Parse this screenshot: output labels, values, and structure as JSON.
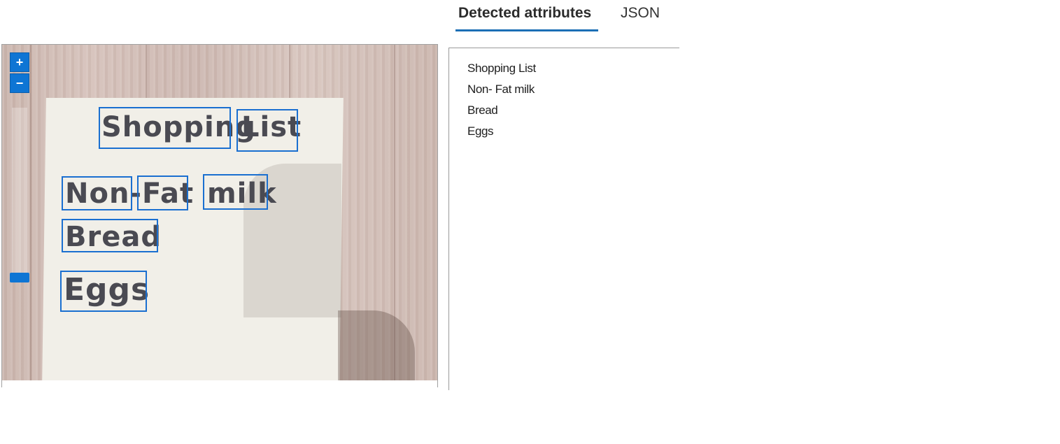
{
  "tabs": [
    {
      "label": "Detected attributes",
      "active": true
    },
    {
      "label": "JSON",
      "active": false
    }
  ],
  "viewer": {
    "zoom_in_label": "+",
    "zoom_out_label": "−",
    "handwriting": {
      "word1": "Shopping",
      "word2": "List",
      "word3": "Non-",
      "word4": "Fat",
      "word5": "milk",
      "word6": "Bread",
      "word7": "Eggs"
    },
    "box_color": "#1a6fd0"
  },
  "results": {
    "lines": [
      "Shopping List",
      "Non- Fat milk",
      "Bread",
      "Eggs"
    ]
  },
  "colors": {
    "accent": "#1b6fb5",
    "zoom_button": "#0e75d4"
  }
}
